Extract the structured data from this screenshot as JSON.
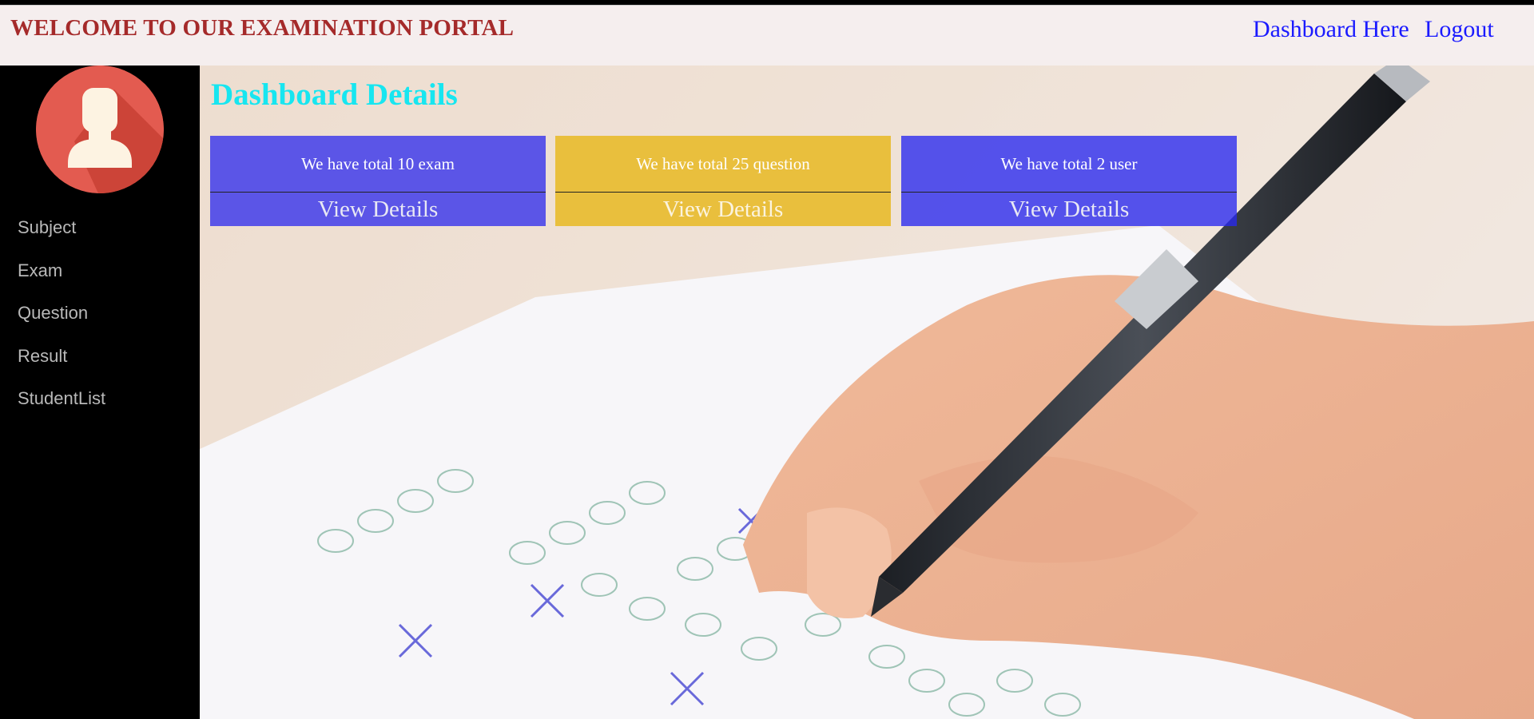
{
  "header": {
    "brand": "WELCOME TO OUR EXAMINATION PORTAL",
    "nav": {
      "dashboard": "Dashboard Here",
      "logout": "Logout"
    }
  },
  "sidebar": {
    "avatar_icon": "user-avatar-icon",
    "items": [
      {
        "label": "Subject"
      },
      {
        "label": "Exam"
      },
      {
        "label": "Question"
      },
      {
        "label": "Result"
      },
      {
        "label": "StudentList"
      }
    ]
  },
  "main": {
    "title": "Dashboard Details",
    "cards": [
      {
        "text": "We have total 10 exam",
        "link": "View Details",
        "color": "#4a46e9"
      },
      {
        "text": "We have total 25 question",
        "link": "View Details",
        "color": "#e8be38"
      },
      {
        "text": "We have total 2 user",
        "link": "View Details",
        "color": "#2828f0"
      }
    ]
  },
  "colors": {
    "brand": "#a52a2a",
    "title": "#17e6f0",
    "nav_link": "#1a1aff",
    "sidebar_bg": "#000000",
    "header_bg": "#f5eeee"
  }
}
